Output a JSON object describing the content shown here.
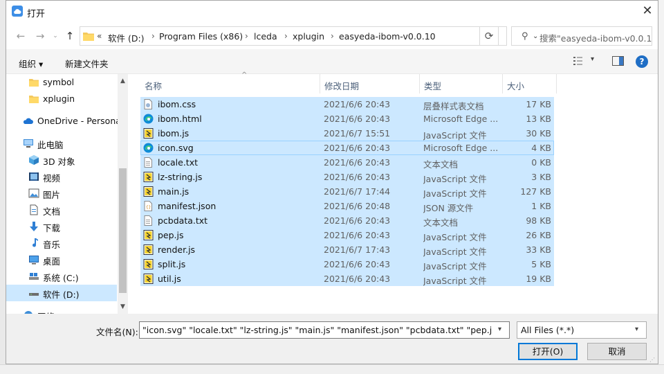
{
  "window": {
    "title": "打开"
  },
  "address": {
    "overflow": "«",
    "crumbs": [
      "软件 (D:)",
      "Program Files (x86)",
      "lceda",
      "xplugin",
      "easyeda-ibom-v0.0.10"
    ]
  },
  "search": {
    "placeholder": "搜索\"easyeda-ibom-v0.0.1..."
  },
  "toolbar": {
    "organize": "组织 ▾",
    "new_folder": "新建文件夹"
  },
  "sidebar": {
    "items": [
      {
        "label": "symbol",
        "icon": "folder-icon"
      },
      {
        "label": "xplugin",
        "icon": "folder-icon"
      },
      {
        "label": "OneDrive - Persona",
        "icon": "cloud-icon"
      },
      {
        "label": "此电脑",
        "icon": "computer-icon"
      },
      {
        "label": "3D 对象",
        "icon": "cube-icon"
      },
      {
        "label": "视频",
        "icon": "video-icon"
      },
      {
        "label": "图片",
        "icon": "picture-icon"
      },
      {
        "label": "文档",
        "icon": "document-icon"
      },
      {
        "label": "下载",
        "icon": "download-icon"
      },
      {
        "label": "音乐",
        "icon": "music-icon"
      },
      {
        "label": "桌面",
        "icon": "desktop-icon"
      },
      {
        "label": "系统 (C:)",
        "icon": "drive-icon"
      },
      {
        "label": "软件 (D:)",
        "icon": "drive-icon"
      },
      {
        "label": "网络",
        "icon": "network-icon"
      }
    ]
  },
  "columns": {
    "name": "名称",
    "date": "修改日期",
    "type": "类型",
    "size": "大小"
  },
  "files": [
    {
      "name": "ibom.css",
      "date": "2021/6/6 20:43",
      "type": "层叠样式表文档",
      "size": "17 KB",
      "icon": "css-file-icon"
    },
    {
      "name": "ibom.html",
      "date": "2021/6/6 20:43",
      "type": "Microsoft Edge ...",
      "size": "13 KB",
      "icon": "edge-icon"
    },
    {
      "name": "ibom.js",
      "date": "2021/6/7 15:51",
      "type": "JavaScript 文件",
      "size": "30 KB",
      "icon": "js-file-icon"
    },
    {
      "name": "icon.svg",
      "date": "2021/6/6 20:43",
      "type": "Microsoft Edge ...",
      "size": "4 KB",
      "icon": "edge-icon"
    },
    {
      "name": "locale.txt",
      "date": "2021/6/6 20:43",
      "type": "文本文档",
      "size": "0 KB",
      "icon": "text-file-icon"
    },
    {
      "name": "lz-string.js",
      "date": "2021/6/6 20:43",
      "type": "JavaScript 文件",
      "size": "3 KB",
      "icon": "js-file-icon"
    },
    {
      "name": "main.js",
      "date": "2021/6/7 17:44",
      "type": "JavaScript 文件",
      "size": "127 KB",
      "icon": "js-file-icon"
    },
    {
      "name": "manifest.json",
      "date": "2021/6/6 20:48",
      "type": "JSON 源文件",
      "size": "1 KB",
      "icon": "json-file-icon"
    },
    {
      "name": "pcbdata.txt",
      "date": "2021/6/6 20:43",
      "type": "文本文档",
      "size": "98 KB",
      "icon": "text-file-icon"
    },
    {
      "name": "pep.js",
      "date": "2021/6/6 20:43",
      "type": "JavaScript 文件",
      "size": "26 KB",
      "icon": "js-file-icon"
    },
    {
      "name": "render.js",
      "date": "2021/6/7 17:43",
      "type": "JavaScript 文件",
      "size": "33 KB",
      "icon": "js-file-icon"
    },
    {
      "name": "split.js",
      "date": "2021/6/6 20:43",
      "type": "JavaScript 文件",
      "size": "5 KB",
      "icon": "js-file-icon"
    },
    {
      "name": "util.js",
      "date": "2021/6/6 20:43",
      "type": "JavaScript 文件",
      "size": "19 KB",
      "icon": "js-file-icon"
    }
  ],
  "bottom": {
    "filename_label": "文件名(N):",
    "filename_value": "\"icon.svg\" \"locale.txt\" \"lz-string.js\" \"main.js\" \"manifest.json\" \"pcbdata.txt\" \"pep.js\" \"rende",
    "filter": "All Files (*.*)",
    "open": "打开(O)",
    "cancel": "取消"
  },
  "colors": {
    "selection": "#cce8ff",
    "accent": "#0078d7"
  }
}
